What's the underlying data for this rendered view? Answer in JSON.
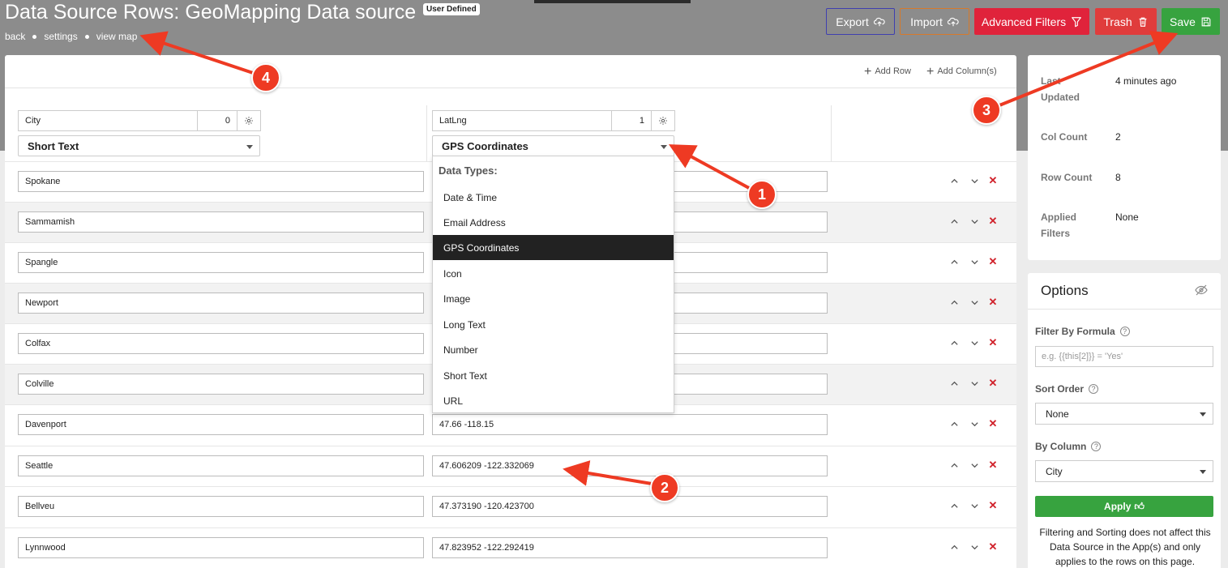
{
  "header": {
    "title": "Data Source Rows: GeoMapping Data source",
    "badge": "User Defined",
    "breadcrumb": [
      "back",
      "settings",
      "view map"
    ],
    "buttons": {
      "export": "Export",
      "import": "Import",
      "advanced_filters": "Advanced Filters",
      "trash": "Trash",
      "save": "Save"
    }
  },
  "toolbar": {
    "add_row": "Add Row",
    "add_columns": "Add Column(s)"
  },
  "columns": [
    {
      "name": "City",
      "index": "0",
      "type": "Short Text"
    },
    {
      "name": "LatLng",
      "index": "1",
      "type": "GPS Coordinates"
    }
  ],
  "rows": [
    {
      "city": "Spokane",
      "latlng": ""
    },
    {
      "city": "Sammamish",
      "latlng": ""
    },
    {
      "city": "Spangle",
      "latlng": ""
    },
    {
      "city": "Newport",
      "latlng": ""
    },
    {
      "city": "Colfax",
      "latlng": ""
    },
    {
      "city": "Colville",
      "latlng": ""
    },
    {
      "city": "Davenport",
      "latlng": "47.66 -118.15"
    },
    {
      "city": "Seattle",
      "latlng": "47.606209 -122.332069"
    },
    {
      "city": "Bellveu",
      "latlng": "47.373190 -120.423700"
    },
    {
      "city": "Lynnwood",
      "latlng": "47.823952 -122.292419"
    }
  ],
  "dropdown": {
    "header": "Data Types:",
    "items": [
      "Date & Time",
      "Email Address",
      "GPS Coordinates",
      "Icon",
      "Image",
      "Long Text",
      "Number",
      "Short Text",
      "URL"
    ],
    "selected": "GPS Coordinates"
  },
  "stats": {
    "last_updated_label": "Last Updated",
    "last_updated_value": "4 minutes ago",
    "col_count_label": "Col Count",
    "col_count_value": "2",
    "row_count_label": "Row Count",
    "row_count_value": "8",
    "applied_filters_label": "Applied Filters",
    "applied_filters_value": "None"
  },
  "options": {
    "title": "Options",
    "filter_label": "Filter By Formula",
    "filter_placeholder": "e.g. {{this[2]}} = 'Yes'",
    "sort_label": "Sort Order",
    "sort_value": "None",
    "by_column_label": "By Column",
    "by_column_value": "City",
    "apply_label": "Apply",
    "note": "Filtering and Sorting does not affect this Data Source in the App(s) and only applies to the rows on this page."
  },
  "annotations": [
    "1",
    "2",
    "3",
    "4"
  ],
  "colors": {
    "accent_red": "#ee3a23",
    "save_green": "#37a33f",
    "advanced_red": "#e0233b"
  }
}
